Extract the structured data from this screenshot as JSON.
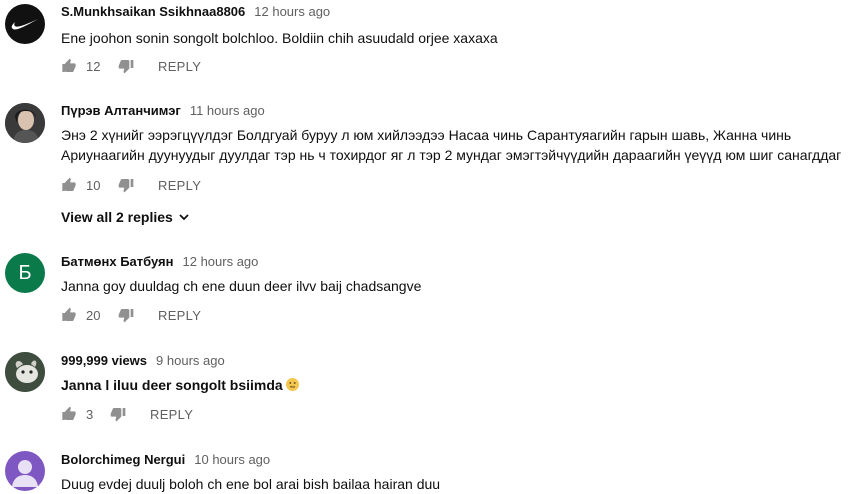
{
  "actions": {
    "reply_label": "REPLY"
  },
  "comments": [
    {
      "author": "S.Munkhsaikan Ssikhnaa8806",
      "time": "12 hours ago",
      "text": "Ene joohon sonin songolt bolchloo. Boldiin chih asuudald orjee xaxaxa",
      "likes": "12",
      "avatar_bg": "#111111",
      "avatar_icon": "nike-swoosh-icon"
    },
    {
      "author": "Пүрэв Алтанчимэг",
      "time": "11 hours ago",
      "text_line1": "Энэ 2 хүнийг ээрэгцүүлдэг Болдгуай буруу л юм хийлээдээ Насаа чинь Сарантуяагийн гарын шавь, Жанна чинь",
      "text_line2": "Ариунаагийн дуунуудыг дуулдаг тэр нь ч тохирдог яг л тэр 2 мундаг эмэгтэйчүүдийн дараагийн үеүүд юм шиг санагддаг",
      "likes": "10",
      "avatar_bg": "#2b2b2b",
      "replies_label": "View all 2 replies"
    },
    {
      "author": "Батмөнх Батбуян",
      "time": "12 hours ago",
      "text": "Janna goy duuldag ch ene duun deer ilvv baij chadsangve",
      "likes": "20",
      "avatar_bg": "#0b7a4b",
      "avatar_letter": "Б"
    },
    {
      "author": "999,999 views",
      "time": "9 hours ago",
      "text": "Janna l iluu deer songolt bsiimda",
      "likes": "3",
      "avatar_bg": "#4a5a4a",
      "emoji": "confused-face-emoji"
    },
    {
      "author": "Bolorchimeg Nergui",
      "time": "10 hours ago",
      "text": "Duug evdej duulj boloh ch ene bol arai bish bailaa hairan duu",
      "avatar_bg": "#7e57c2",
      "avatar_icon": "default-user-icon"
    }
  ]
}
